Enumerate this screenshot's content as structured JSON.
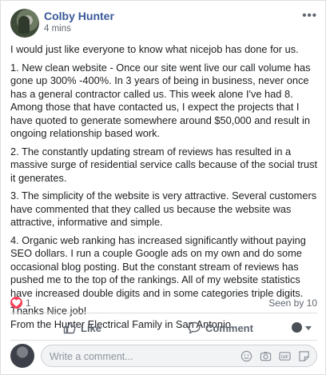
{
  "post": {
    "author": "Colby Hunter",
    "timestamp": "4 mins",
    "more_label": "•••",
    "paragraphs": [
      "I would just like everyone to know what nicejob has done for us.",
      "1. New clean website - Once our site went live our call volume has gone up 300% -400%. In 3 years of being in business, never once has a general contractor called us. This week alone I've had 8. Among those that have contacted us, I expect the projects that I have quoted to generate somewhere around $50,000 and result in ongoing relationship based work.",
      "2. The constantly updating stream of reviews has resulted in a massive surge of residential service calls because of the social trust it generates.",
      "3. The simplicity of the website is very attractive. Several customers have commented that they called us because the website was attractive, informative and simple.",
      "4. Organic web ranking has increased significantly without paying SEO dollars. I run a couple Google ads on my own and do some occasional blog posting. But the constant stream of reviews has pushed me to the top of the rankings. All of my website statistics have increased double digits and in some categories triple digits."
    ],
    "closing_line_1": "Thanks Nice job!",
    "closing_line_2": "From the Hunter Electrical Family in San Antonio."
  },
  "stats": {
    "reaction_icon": "heart-icon",
    "reaction_count": "1",
    "seen_by": "Seen by 10"
  },
  "actions": {
    "like_label": "Like",
    "comment_label": "Comment",
    "audience_icon": "globe-icon"
  },
  "composer": {
    "placeholder": "Write a comment...",
    "icons": [
      "emoji-icon",
      "camera-icon",
      "gif-icon",
      "sticker-icon"
    ]
  },
  "colors": {
    "author_link": "#385898",
    "secondary_text": "#606770",
    "heart": "#f33e58"
  }
}
